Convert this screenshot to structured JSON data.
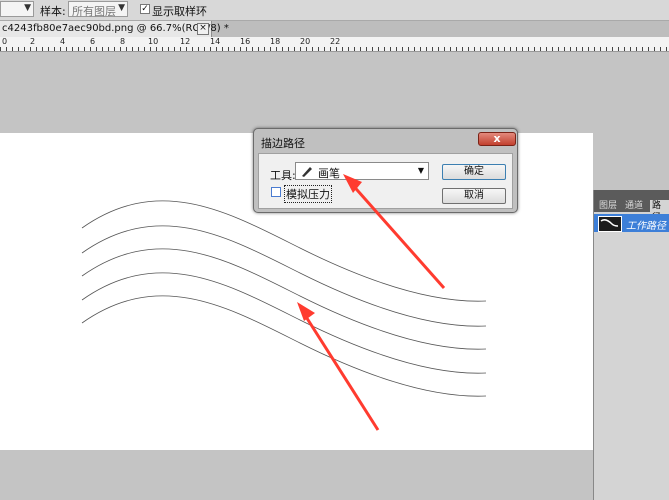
{
  "options_bar": {
    "sample_label": "样本:",
    "sample_value": "所有图层",
    "show_ring_label": "显示取样环",
    "show_ring_checked": true
  },
  "document": {
    "tab_title": "c4243fb80e7aec90bd.png @ 66.7%(RGB/8) *",
    "close_symbol": "×"
  },
  "ruler": {
    "ticks": [
      "0",
      "2",
      "4",
      "6",
      "8",
      "10",
      "12",
      "14",
      "16",
      "18",
      "20",
      "22"
    ]
  },
  "dialog": {
    "title": "描边路径",
    "close_symbol": "x",
    "tool_label": "工具:",
    "tool_value": "画笔",
    "simulate_pressure_label": "模拟压力",
    "simulate_pressure_checked": false,
    "ok_label": "确定",
    "cancel_label": "取消"
  },
  "paths_panel": {
    "tabs": [
      "图层",
      "通道",
      "路径"
    ],
    "active_tab": "路径",
    "work_path_label": "工作路径"
  },
  "annotation_color": "#ff3b2f"
}
